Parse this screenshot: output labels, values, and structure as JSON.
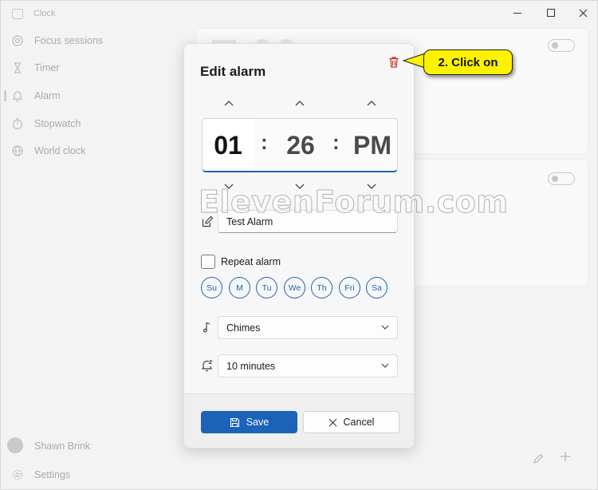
{
  "window": {
    "title": "Clock",
    "controls": [
      "minimize",
      "maximize",
      "close"
    ]
  },
  "sidebar": {
    "items": [
      {
        "label": "Focus sessions",
        "icon": "focus-icon"
      },
      {
        "label": "Timer",
        "icon": "hourglass-icon"
      },
      {
        "label": "Alarm",
        "icon": "bell-icon",
        "selected": true
      },
      {
        "label": "Stopwatch",
        "icon": "stopwatch-icon"
      },
      {
        "label": "World clock",
        "icon": "globe-icon"
      }
    ],
    "account_name": "Shawn Brink",
    "settings_label": "Settings"
  },
  "dialog": {
    "title": "Edit alarm",
    "hour": "01",
    "minute": "26",
    "ampm": "PM",
    "separator": ":",
    "alarm_name": "Test Alarm",
    "repeat_label": "Repeat alarm",
    "repeat_checked": false,
    "days": [
      "Su",
      "M",
      "Tu",
      "We",
      "Th",
      "Fri",
      "Sa"
    ],
    "sound": "Chimes",
    "snooze": "10 minutes",
    "save_label": "Save",
    "cancel_label": "Cancel"
  },
  "callout": {
    "text": "2. Click on"
  },
  "watermark": "ElevenForum.com",
  "colors": {
    "accent": "#1a63b8",
    "delete": "#c42b1c",
    "callout": "#fff200"
  }
}
